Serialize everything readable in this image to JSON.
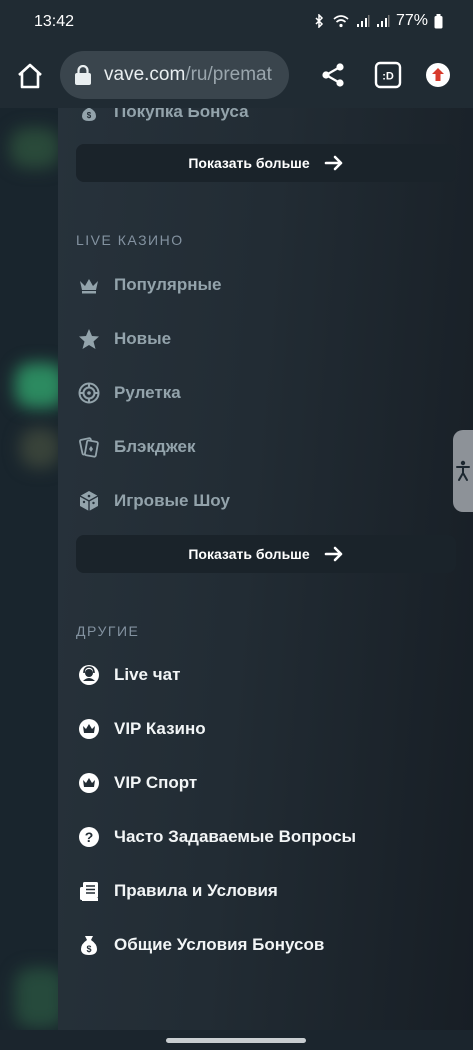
{
  "status_bar": {
    "time": "13:42",
    "battery": "77%"
  },
  "browser": {
    "url_main": "vave.com",
    "url_path": "/ru/premat",
    "tab_label": ":D"
  },
  "menu": {
    "top_partial_item": "Покупка Бонуса",
    "show_more_label": "Показать больше",
    "live_casino": {
      "title": "LIVE КАЗИНО",
      "items": [
        {
          "label": "Популярные",
          "icon": "crown-icon"
        },
        {
          "label": "Новые",
          "icon": "star-icon"
        },
        {
          "label": "Рулетка",
          "icon": "roulette-icon"
        },
        {
          "label": "Блэкджек",
          "icon": "cards-icon"
        },
        {
          "label": "Игровые Шоу",
          "icon": "dice-icon"
        }
      ],
      "show_more_label": "Показать больше"
    },
    "other": {
      "title": "ДРУГИЕ",
      "items": [
        {
          "label": "Live чат",
          "icon": "chat-support-icon"
        },
        {
          "label": "VIP Казино",
          "icon": "vip-crown-icon"
        },
        {
          "label": "VIP Спорт",
          "icon": "vip-crown-icon"
        },
        {
          "label": "Часто Задаваемые Вопросы",
          "icon": "question-icon"
        },
        {
          "label": "Правила и Условия",
          "icon": "document-icon"
        },
        {
          "label": "Общие Условия Бонусов",
          "icon": "money-bag-icon"
        }
      ]
    }
  },
  "colors": {
    "panel_bg": "#222c34",
    "muted_text": "#93a3ab",
    "bright_text": "#f2f5f6",
    "section_title": "#8392a0"
  }
}
